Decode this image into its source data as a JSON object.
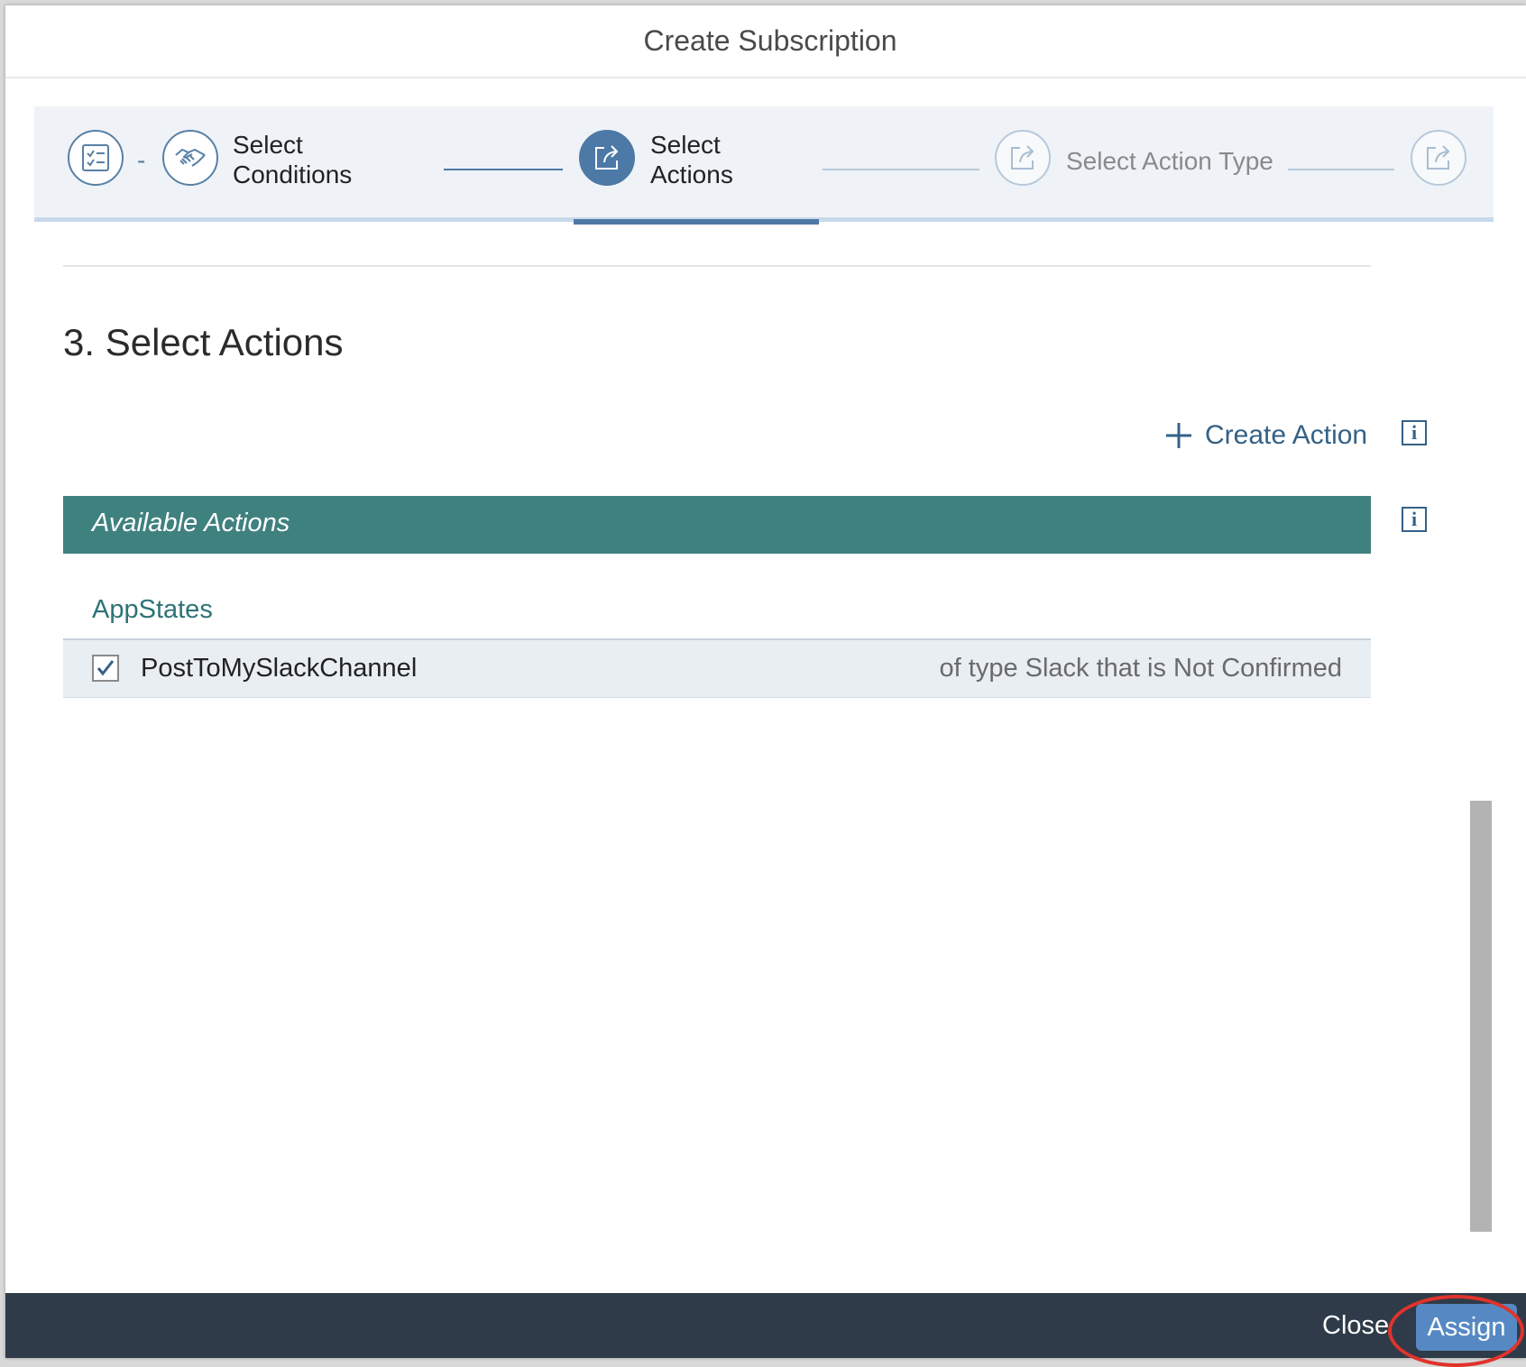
{
  "dialog": {
    "title": "Create Subscription"
  },
  "wizard": {
    "separator": "-",
    "steps": [
      {
        "label_line1": "Select",
        "label_line2": "Conditions",
        "state": "completed",
        "icon": "handshake-icon"
      },
      {
        "label_line1": "Select",
        "label_line2": "Actions",
        "state": "active",
        "icon": "share-icon"
      },
      {
        "label": "Select Action Type",
        "state": "future",
        "icon": "share-icon"
      },
      {
        "state": "future",
        "icon": "share-icon"
      }
    ],
    "first_icon": "checklist-icon"
  },
  "section": {
    "title": "3. Select Actions"
  },
  "toolbar": {
    "create_action_label": "Create Action"
  },
  "available_actions": {
    "header": "Available Actions",
    "groups": [
      {
        "name": "AppStates",
        "items": [
          {
            "name": "PostToMySlackChannel",
            "description": "of type Slack that is Not Confirmed",
            "checked": true
          }
        ]
      }
    ]
  },
  "footer": {
    "close_label": "Close",
    "assign_label": "Assign"
  },
  "colors": {
    "accent": "#4d79a6",
    "header_bar": "#3f817f",
    "footer_bg": "#2f3b48",
    "assign_button": "#5689c4",
    "highlight": "#e0332c"
  }
}
